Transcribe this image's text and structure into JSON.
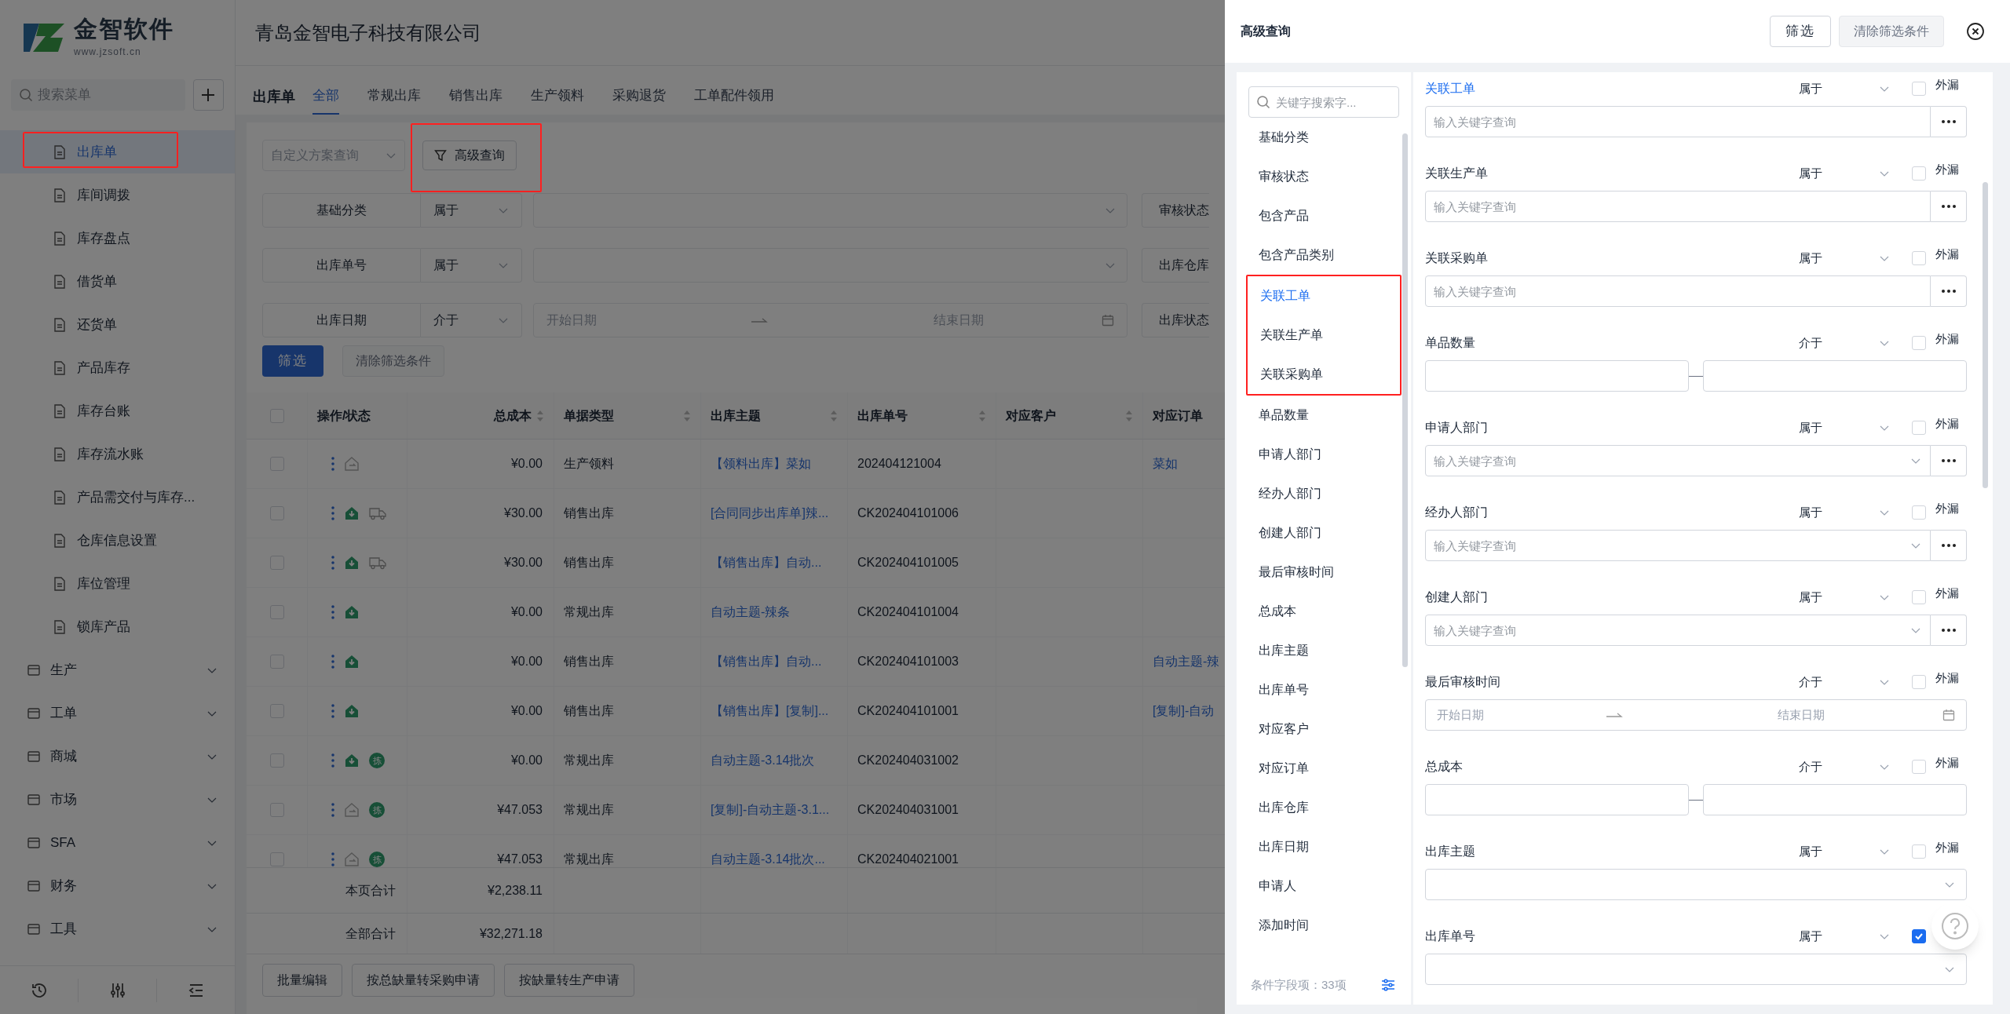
{
  "sidebar": {
    "brand": "金智软件",
    "url": "www.jzsoft.cn",
    "search_placeholder": "搜索菜单",
    "items": [
      {
        "label": "出库单",
        "selected": true,
        "highlighted": true
      },
      {
        "label": "库间调拨",
        "selected": false,
        "highlighted": false
      },
      {
        "label": "库存盘点",
        "selected": false,
        "highlighted": false
      },
      {
        "label": "借货单",
        "selected": false,
        "highlighted": false
      },
      {
        "label": "还货单",
        "selected": false,
        "highlighted": false
      },
      {
        "label": "产品库存",
        "selected": false,
        "highlighted": false
      },
      {
        "label": "库存台账",
        "selected": false,
        "highlighted": false
      },
      {
        "label": "库存流水账",
        "selected": false,
        "highlighted": false
      },
      {
        "label": "产品需交付与库存...",
        "selected": false,
        "highlighted": false
      },
      {
        "label": "仓库信息设置",
        "selected": false,
        "highlighted": false
      },
      {
        "label": "库位管理",
        "selected": false,
        "highlighted": false
      },
      {
        "label": "锁库产品",
        "selected": false,
        "highlighted": false
      }
    ],
    "groups": [
      {
        "label": "生产",
        "expanded": false
      },
      {
        "label": "工单",
        "expanded": false
      },
      {
        "label": "商城",
        "expanded": false
      },
      {
        "label": "市场",
        "expanded": false
      },
      {
        "label": "SFA",
        "expanded": false
      },
      {
        "label": "财务",
        "expanded": false
      },
      {
        "label": "工具",
        "expanded": false
      }
    ]
  },
  "header": {
    "company": "青岛金智电子科技有限公司"
  },
  "page": {
    "title": "出库单",
    "tabs": [
      {
        "label": "全部",
        "selected": true
      },
      {
        "label": "常规出库",
        "selected": false
      },
      {
        "label": "销售出库",
        "selected": false
      },
      {
        "label": "生产领料",
        "selected": false
      },
      {
        "label": "采购退货",
        "selected": false
      },
      {
        "label": "工单配件领用",
        "selected": false
      }
    ]
  },
  "filters": {
    "scheme_placeholder": "自定义方案查询",
    "advanced_button": {
      "label": "高级查询",
      "highlighted": true
    },
    "rows": [
      {
        "label": "基础分类",
        "operator": "属于",
        "value": {
          "kind": "select"
        },
        "next_label": "审核状态"
      },
      {
        "label": "出库单号",
        "operator": "属于",
        "value": {
          "kind": "select"
        },
        "next_label": "出库仓库"
      },
      {
        "label": "出库日期",
        "operator": "介于",
        "value": {
          "kind": "date_range",
          "start_placeholder": "开始日期",
          "end_placeholder": "结束日期"
        },
        "next_label": "出库状态"
      }
    ],
    "apply_button": "筛选",
    "clear_button": {
      "label": "清除筛选条件",
      "disabled": true
    }
  },
  "table": {
    "columns": [
      {
        "label": "操作/状态",
        "sortable": false
      },
      {
        "label": "总成本",
        "sortable": true
      },
      {
        "label": "单据类型",
        "sortable": true
      },
      {
        "label": "出库主题",
        "sortable": true
      },
      {
        "label": "出库单号",
        "sortable": true
      },
      {
        "label": "对应客户",
        "sortable": true
      },
      {
        "label": "对应订单",
        "sortable": false
      }
    ],
    "select_all_checked": false,
    "rows": [
      {
        "checked": false,
        "status": {
          "kind": "pending"
        },
        "cost": "¥0.00",
        "type": "生产领料",
        "subject": "【领料出库】菜如",
        "number": "202404121004",
        "order": "菜如"
      },
      {
        "checked": false,
        "status": {
          "kind": "done"
        },
        "extra": {
          "kind": "truck"
        },
        "cost": "¥30.00",
        "type": "销售出库",
        "subject": "[合同同步出库单]辣...",
        "number": "CK202404101006"
      },
      {
        "checked": false,
        "status": {
          "kind": "done"
        },
        "extra": {
          "kind": "truck"
        },
        "cost": "¥30.00",
        "type": "销售出库",
        "subject": "【销售出库】自动...",
        "number": "CK202404101005"
      },
      {
        "checked": false,
        "status": {
          "kind": "done"
        },
        "cost": "¥0.00",
        "type": "常规出库",
        "subject": "自动主题-辣条",
        "number": "CK202404101004"
      },
      {
        "checked": false,
        "status": {
          "kind": "done"
        },
        "cost": "¥0.00",
        "type": "销售出库",
        "subject": "【销售出库】自动...",
        "number": "CK202404101003",
        "order": "自动主题-辣"
      },
      {
        "checked": false,
        "status": {
          "kind": "done"
        },
        "cost": "¥0.00",
        "type": "销售出库",
        "subject": "【销售出库】[复制]...",
        "number": "CK202404101001",
        "order": "[复制]-自动"
      },
      {
        "checked": false,
        "status": {
          "kind": "done"
        },
        "extra": {
          "kind": "pick",
          "text": "拣"
        },
        "cost": "¥0.00",
        "type": "常规出库",
        "subject": "自动主题-3.14批次",
        "number": "CK202404031002"
      },
      {
        "checked": false,
        "status": {
          "kind": "pending"
        },
        "extra": {
          "kind": "pick",
          "text": "拣"
        },
        "cost": "¥47.053",
        "type": "常规出库",
        "subject": "[复制]-自动主题-3.1...",
        "number": "CK202404031001"
      },
      {
        "checked": false,
        "status": {
          "kind": "pending"
        },
        "extra": {
          "kind": "pick",
          "text": "拣"
        },
        "cost": "¥47.053",
        "type": "常规出库",
        "subject": "自动主题-3.14批次...",
        "number": "CK202404021001"
      }
    ],
    "summary": [
      {
        "label": "本页合计",
        "value": "¥2,238.11"
      },
      {
        "label": "全部合计",
        "value": "¥32,271.18"
      }
    ]
  },
  "bottom_buttons": [
    "批量编辑",
    "按总缺量转采购申请",
    "按缺量转生产申请"
  ],
  "drawer": {
    "title": "高级查询",
    "apply_button": "筛选",
    "clear_button": {
      "label": "清除筛选条件",
      "disabled": true
    },
    "search_placeholder": "关键字搜索字...",
    "field_list": [
      {
        "label": "基础分类",
        "selected": false,
        "highlighted": false
      },
      {
        "label": "审核状态",
        "selected": false,
        "highlighted": false
      },
      {
        "label": "包含产品",
        "selected": false,
        "highlighted": false
      },
      {
        "label": "包含产品类别",
        "selected": false,
        "highlighted": false
      },
      {
        "label": "关联工单",
        "selected": true,
        "highlighted": true
      },
      {
        "label": "关联生产单",
        "selected": false,
        "highlighted": true
      },
      {
        "label": "关联采购单",
        "selected": false,
        "highlighted": true
      },
      {
        "label": "单品数量",
        "selected": false,
        "highlighted": false
      },
      {
        "label": "申请人部门",
        "selected": false,
        "highlighted": false
      },
      {
        "label": "经办人部门",
        "selected": false,
        "highlighted": false
      },
      {
        "label": "创建人部门",
        "selected": false,
        "highlighted": false
      },
      {
        "label": "最后审核时间",
        "selected": false,
        "highlighted": false
      },
      {
        "label": "总成本",
        "selected": false,
        "highlighted": false
      },
      {
        "label": "出库主题",
        "selected": false,
        "highlighted": false
      },
      {
        "label": "出库单号",
        "selected": false,
        "highlighted": false
      },
      {
        "label": "对应客户",
        "selected": false,
        "highlighted": false
      },
      {
        "label": "对应订单",
        "selected": false,
        "highlighted": false
      },
      {
        "label": "出库仓库",
        "selected": false,
        "highlighted": false
      },
      {
        "label": "出库日期",
        "selected": false,
        "highlighted": false
      },
      {
        "label": "申请人",
        "selected": false,
        "highlighted": false
      },
      {
        "label": "添加时间",
        "selected": false,
        "highlighted": false
      }
    ],
    "field_count": "条件字段项：33项",
    "fields": [
      {
        "label": "关联工单",
        "selected": true,
        "operator": "属于",
        "exclude_label": "外漏",
        "exclude_checked": false,
        "input": {
          "kind": "lookup",
          "placeholder": "输入关键字查询"
        }
      },
      {
        "label": "关联生产单",
        "selected": false,
        "operator": "属于",
        "exclude_label": "外漏",
        "exclude_checked": false,
        "input": {
          "kind": "lookup",
          "placeholder": "输入关键字查询"
        }
      },
      {
        "label": "关联采购单",
        "selected": false,
        "operator": "属于",
        "exclude_label": "外漏",
        "exclude_checked": false,
        "input": {
          "kind": "lookup",
          "placeholder": "输入关键字查询"
        }
      },
      {
        "label": "单品数量",
        "selected": false,
        "operator": "介于",
        "exclude_label": "外漏",
        "exclude_checked": false,
        "input": {
          "kind": "range"
        }
      },
      {
        "label": "申请人部门",
        "selected": false,
        "operator": "属于",
        "exclude_label": "外漏",
        "exclude_checked": false,
        "input": {
          "kind": "lookup_select",
          "placeholder": "输入关键字查询"
        }
      },
      {
        "label": "经办人部门",
        "selected": false,
        "operator": "属于",
        "exclude_label": "外漏",
        "exclude_checked": false,
        "input": {
          "kind": "lookup_select",
          "placeholder": "输入关键字查询"
        }
      },
      {
        "label": "创建人部门",
        "selected": false,
        "operator": "属于",
        "exclude_label": "外漏",
        "exclude_checked": false,
        "input": {
          "kind": "lookup_select",
          "placeholder": "输入关键字查询"
        }
      },
      {
        "label": "最后审核时间",
        "selected": false,
        "operator": "介于",
        "exclude_label": "外漏",
        "exclude_checked": false,
        "input": {
          "kind": "date_range",
          "start_placeholder": "开始日期",
          "end_placeholder": "结束日期"
        }
      },
      {
        "label": "总成本",
        "selected": false,
        "operator": "介于",
        "exclude_label": "外漏",
        "exclude_checked": false,
        "input": {
          "kind": "range"
        }
      },
      {
        "label": "出库主题",
        "selected": false,
        "operator": "属于",
        "exclude_label": "外漏",
        "exclude_checked": false,
        "input": {
          "kind": "select"
        }
      },
      {
        "label": "出库单号",
        "selected": false,
        "operator": "属于",
        "exclude_checked": true,
        "input": {
          "kind": "select"
        }
      }
    ]
  }
}
